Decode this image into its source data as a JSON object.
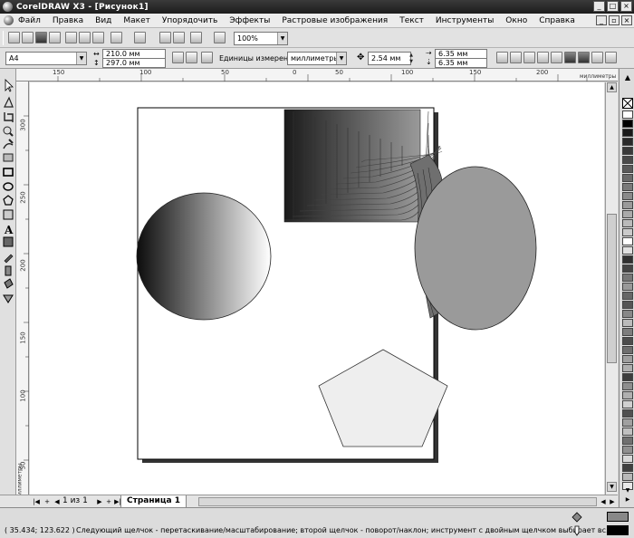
{
  "window": {
    "title": "CorelDRAW X3 - [Рисунок1]"
  },
  "menu": {
    "items": [
      "Файл",
      "Правка",
      "Вид",
      "Макет",
      "Упорядочить",
      "Эффекты",
      "Растровые изображения",
      "Текст",
      "Инструменты",
      "Окно",
      "Справка"
    ]
  },
  "standard_toolbar": {
    "zoom": "100%"
  },
  "property_bar": {
    "page_size": "A4",
    "width": "210.0 мм",
    "height": "297.0 мм",
    "units_label": "Единицы измерения:",
    "units_value": "миллиметры",
    "nudge": "2.54 мм",
    "dup_x": "6.35 мм",
    "dup_y": "6.35 мм"
  },
  "rulers": {
    "h_ticks": [
      "150",
      "100",
      "50",
      "0",
      "50",
      "100",
      "150",
      "200"
    ],
    "h_unit": "миллиметры",
    "v_ticks": [
      "300",
      "250",
      "200",
      "150",
      "100",
      "50"
    ],
    "v_unit": "миллиметры"
  },
  "page_nav": {
    "counter": "1 из 1",
    "tab": "Страница 1"
  },
  "status": {
    "coords": "( 35.434; 123.622 )",
    "hint": "Следующий щелчок - перетаскивание/масштабирование; второй щелчок - поворот/наклон; инструмент с двойным щелчком выбирает вс..."
  },
  "palette_colors": [
    "#ffffff",
    "#000000",
    "#1a1a1a",
    "#2a2a2a",
    "#3a3a3a",
    "#4a4a4a",
    "#5a5a5a",
    "#6a6a6a",
    "#7a7a7a",
    "#8a8a8a",
    "#9a9a9a",
    "#aaaaaa",
    "#bababa",
    "#cacaca",
    "#ffffff",
    "#e0e0e0",
    "#303030",
    "#444444",
    "#777777",
    "#999999",
    "#666666",
    "#555555",
    "#888888",
    "#bbbbbb",
    "#7d7d7d",
    "#4d4d4d",
    "#6e6e6e",
    "#9e9e9e",
    "#aeaeae",
    "#3d3d3d",
    "#8e8e8e",
    "#b0b0b0",
    "#d0d0d0",
    "#505050",
    "#a0a0a0",
    "#c0c0c0",
    "#707070",
    "#909090",
    "#d8d8d8",
    "#404040",
    "#b8b8b8",
    "#e8e8e8"
  ]
}
